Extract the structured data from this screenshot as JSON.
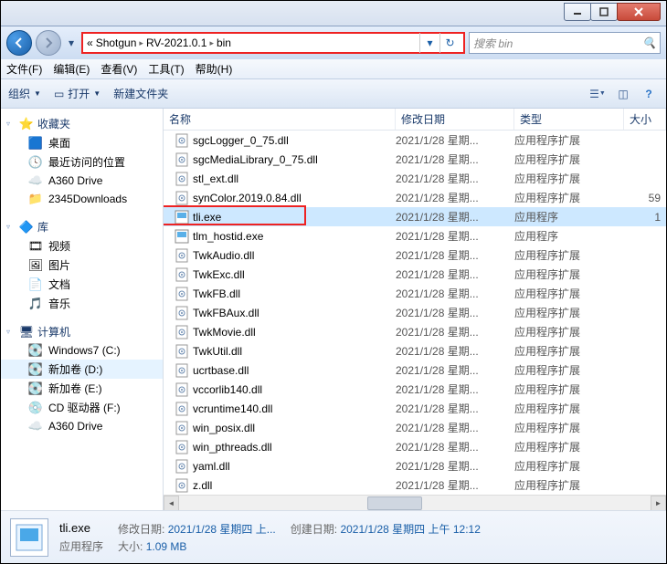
{
  "breadcrumb": {
    "pre": "«",
    "parts": [
      "Shotgun",
      "RV-2021.0.1",
      "bin"
    ]
  },
  "search": {
    "placeholder": "搜索 bin"
  },
  "menu": {
    "file": "文件(F)",
    "edit": "编辑(E)",
    "view": "查看(V)",
    "tools": "工具(T)",
    "help": "帮助(H)"
  },
  "toolbar": {
    "organize": "组织",
    "open": "打开",
    "newfolder": "新建文件夹"
  },
  "nav": {
    "favorites": {
      "label": "收藏夹",
      "items": [
        {
          "label": "桌面",
          "icon": "🟦"
        },
        {
          "label": "最近访问的位置",
          "icon": "🕓"
        },
        {
          "label": "A360 Drive",
          "icon": "☁️"
        },
        {
          "label": "2345Downloads",
          "icon": "📁"
        }
      ]
    },
    "libraries": {
      "label": "库",
      "items": [
        {
          "label": "视频",
          "icon": "🎞"
        },
        {
          "label": "图片",
          "icon": "🖼"
        },
        {
          "label": "文档",
          "icon": "📄"
        },
        {
          "label": "音乐",
          "icon": "🎵"
        }
      ]
    },
    "computer": {
      "label": "计算机",
      "items": [
        {
          "label": "Windows7 (C:)",
          "icon": "💽"
        },
        {
          "label": "新加卷 (D:)",
          "icon": "💽",
          "selected": true
        },
        {
          "label": "新加卷 (E:)",
          "icon": "💽"
        },
        {
          "label": "CD 驱动器 (F:)",
          "icon": "💿"
        },
        {
          "label": "A360 Drive",
          "icon": "☁️"
        }
      ]
    }
  },
  "columns": {
    "name": "名称",
    "date": "修改日期",
    "type": "类型",
    "size": "大小"
  },
  "files": [
    {
      "name": "sgcLogger_0_75.dll",
      "date": "2021/1/28 星期...",
      "type": "应用程序扩展",
      "size": "",
      "icon": "dll"
    },
    {
      "name": "sgcMediaLibrary_0_75.dll",
      "date": "2021/1/28 星期...",
      "type": "应用程序扩展",
      "size": "",
      "icon": "dll"
    },
    {
      "name": "stl_ext.dll",
      "date": "2021/1/28 星期...",
      "type": "应用程序扩展",
      "size": "",
      "icon": "dll"
    },
    {
      "name": "synColor.2019.0.84.dll",
      "date": "2021/1/28 星期...",
      "type": "应用程序扩展",
      "size": "59",
      "icon": "dll"
    },
    {
      "name": "tli.exe",
      "date": "2021/1/28 星期...",
      "type": "应用程序",
      "size": "1",
      "icon": "exe",
      "selected": true,
      "highlight": true
    },
    {
      "name": "tlm_hostid.exe",
      "date": "2021/1/28 星期...",
      "type": "应用程序",
      "size": "",
      "icon": "exe"
    },
    {
      "name": "TwkAudio.dll",
      "date": "2021/1/28 星期...",
      "type": "应用程序扩展",
      "size": "",
      "icon": "dll"
    },
    {
      "name": "TwkExc.dll",
      "date": "2021/1/28 星期...",
      "type": "应用程序扩展",
      "size": "",
      "icon": "dll"
    },
    {
      "name": "TwkFB.dll",
      "date": "2021/1/28 星期...",
      "type": "应用程序扩展",
      "size": "",
      "icon": "dll"
    },
    {
      "name": "TwkFBAux.dll",
      "date": "2021/1/28 星期...",
      "type": "应用程序扩展",
      "size": "",
      "icon": "dll"
    },
    {
      "name": "TwkMovie.dll",
      "date": "2021/1/28 星期...",
      "type": "应用程序扩展",
      "size": "",
      "icon": "dll"
    },
    {
      "name": "TwkUtil.dll",
      "date": "2021/1/28 星期...",
      "type": "应用程序扩展",
      "size": "",
      "icon": "dll"
    },
    {
      "name": "ucrtbase.dll",
      "date": "2021/1/28 星期...",
      "type": "应用程序扩展",
      "size": "",
      "icon": "dll"
    },
    {
      "name": "vccorlib140.dll",
      "date": "2021/1/28 星期...",
      "type": "应用程序扩展",
      "size": "",
      "icon": "dll"
    },
    {
      "name": "vcruntime140.dll",
      "date": "2021/1/28 星期...",
      "type": "应用程序扩展",
      "size": "",
      "icon": "dll"
    },
    {
      "name": "win_posix.dll",
      "date": "2021/1/28 星期...",
      "type": "应用程序扩展",
      "size": "",
      "icon": "dll"
    },
    {
      "name": "win_pthreads.dll",
      "date": "2021/1/28 星期...",
      "type": "应用程序扩展",
      "size": "",
      "icon": "dll"
    },
    {
      "name": "yaml.dll",
      "date": "2021/1/28 星期...",
      "type": "应用程序扩展",
      "size": "",
      "icon": "dll"
    },
    {
      "name": "z.dll",
      "date": "2021/1/28 星期...",
      "type": "应用程序扩展",
      "size": "",
      "icon": "dll"
    }
  ],
  "details": {
    "name": "tli.exe",
    "type": "应用程序",
    "mod_label": "修改日期:",
    "mod_val": "2021/1/28 星期四 上...",
    "create_label": "创建日期:",
    "create_val": "2021/1/28 星期四 上午 12:12",
    "size_label": "大小:",
    "size_val": "1.09 MB"
  }
}
